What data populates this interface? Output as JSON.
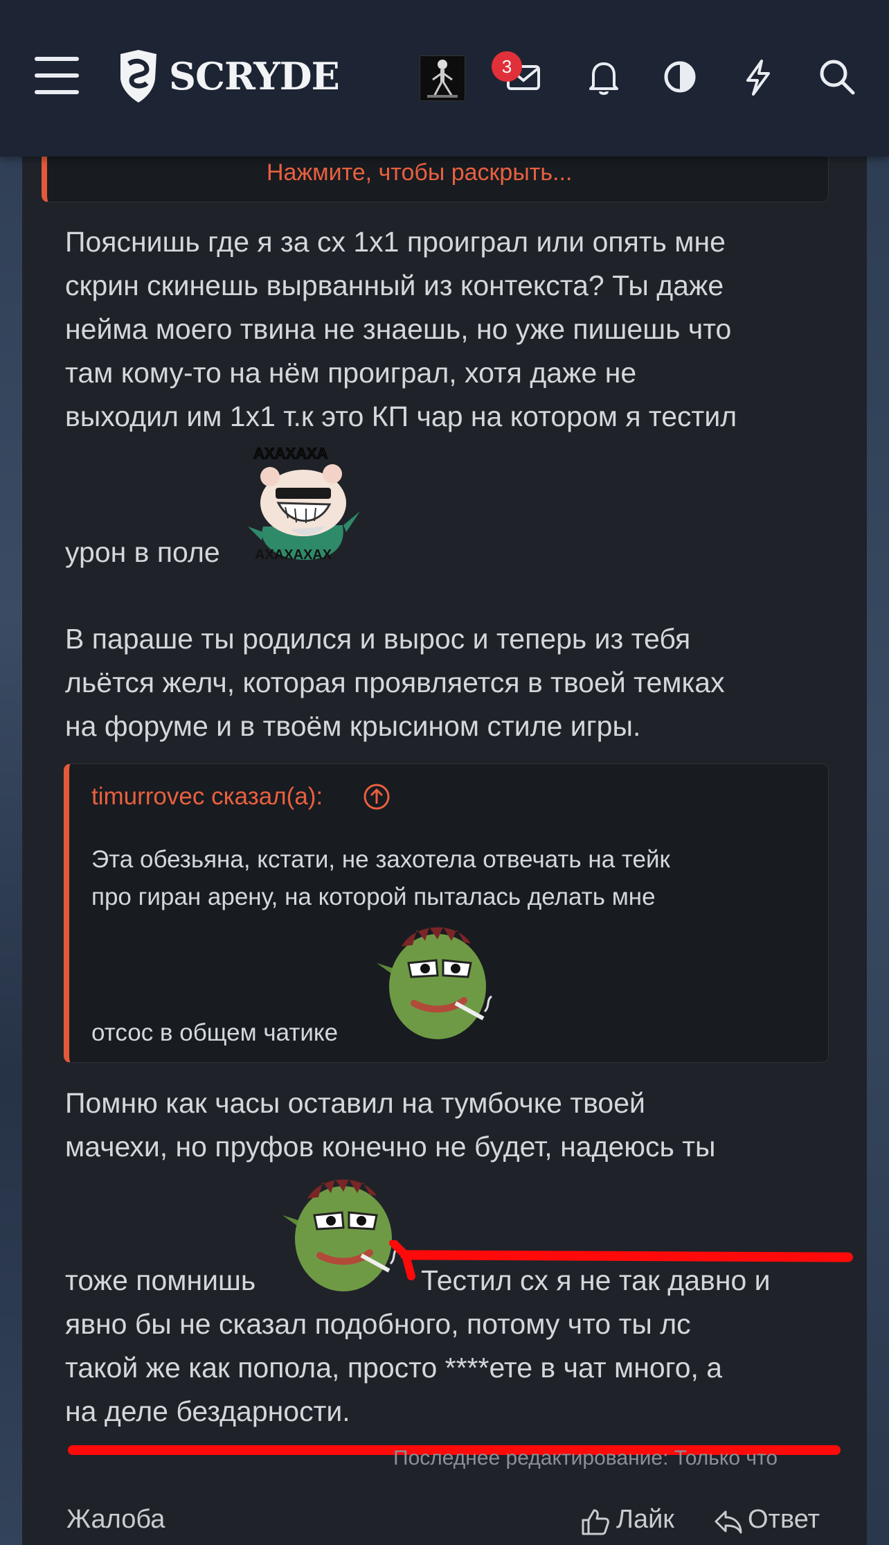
{
  "header": {
    "logo_text": "SCRYDE",
    "messages_badge": "3",
    "icons": [
      "menu-icon",
      "scryde-logo",
      "user-avatar",
      "envelope-icon",
      "bell-icon",
      "contrast-icon",
      "lightning-icon",
      "search-icon"
    ]
  },
  "quote_top": {
    "expand_label": "Нажмите, чтобы раскрыть..."
  },
  "body": {
    "p1_lines": [
      "Пояснишь где я за сх 1х1 проиграл или опять мне",
      "скрин скинешь вырванный из контекста? Ты даже",
      "нейма моего твина не знаешь, но уже пишешь что",
      "там кому-то на нём проиграл, хотя даже не",
      "выходил им 1х1 т.к это КП чар на котором я тестил"
    ],
    "p1_tail": "урон в поле",
    "sticker1_top": "АХАХАХА",
    "sticker1_bottom": "АХАХАХАХ",
    "p2_lines": [
      "В параше ты родился и вырос и теперь из тебя",
      "льётся желч, которая проявляется в твоей темках",
      "на форуме и в твоём крысином стиле игры."
    ],
    "p3_lines": [
      "Помню как часы оставил на тумбочке твоей",
      "мачехи, но пруфов конечно не будет, надеюсь ты"
    ],
    "p3_tail_left": "тоже помнишь",
    "p3_tail_right": "Тестил сх я не так давно и",
    "p4_lines": [
      "явно бы не сказал подобного, потому что ты лс",
      "такой же как попола, просто ****ете в чат много, а",
      "на деле бездарности."
    ]
  },
  "quote2": {
    "author": "timurrovec сказал(а):",
    "lines": [
      "Эта обезьяна, кстати, не захотела отвечать на тейк",
      "про гиран арену, на которой пыталась делать мне"
    ],
    "tail": "отсос в общем чатике"
  },
  "footer": {
    "edited": "Последнее редактирование: Только что",
    "report": "Жалоба",
    "like": "Лайк",
    "reply": "Ответ"
  },
  "colors": {
    "accent": "#e9603f",
    "annotation_red": "#ff0a0a",
    "badge": "#e0303a"
  }
}
